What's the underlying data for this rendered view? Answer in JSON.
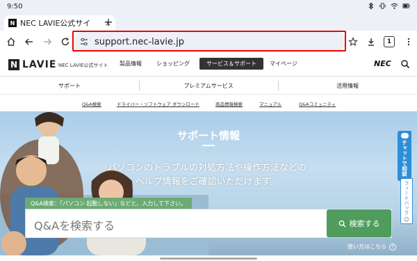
{
  "status_bar": {
    "time": "9:50"
  },
  "tab": {
    "title": "NEC LAVIE公式サイ",
    "close": "×",
    "new_tab": "+"
  },
  "toolbar": {
    "url": "support.nec-lavie.jp",
    "tab_count": "1"
  },
  "site_header": {
    "logo_text": "LAVIE",
    "official_label": "NEC LAVIE公式サイト",
    "nav": [
      {
        "label": "製品情報"
      },
      {
        "label": "ショッピング"
      },
      {
        "label": "サービス＆サポート"
      },
      {
        "label": "マイページ"
      }
    ],
    "brand": "NEC"
  },
  "category_nav": [
    {
      "label": "サポート"
    },
    {
      "label": "プレミアムサービス"
    },
    {
      "label": "活用情報"
    }
  ],
  "sub_links": [
    {
      "label": "Q&A検索"
    },
    {
      "label": "ドライバー・ソフトウェア ダウンロード"
    },
    {
      "label": "商品情報検索"
    },
    {
      "label": "マニュアル"
    },
    {
      "label": "Q&Aコミュニティ"
    }
  ],
  "hero": {
    "title": "サポート情報",
    "line1": "パソコンのトラブルの対処方法や操作方法などの",
    "line2": "ヘルプ情報をご確認いただけます。",
    "hint": "Q&A検索：「パソコン 起動しない」などと、入力して下さい。",
    "search_placeholder": "Q&Aを検索する",
    "search_button": "検索する",
    "howto": "使い方はこちら"
  },
  "side_tabs": {
    "chat": "チャットで相談",
    "feedback": "フィードバック"
  },
  "colors": {
    "accent_green": "#4f9c5c",
    "hint_green": "#6cab74",
    "chat_blue": "#2d8ed6",
    "highlight_red": "#e00000"
  }
}
